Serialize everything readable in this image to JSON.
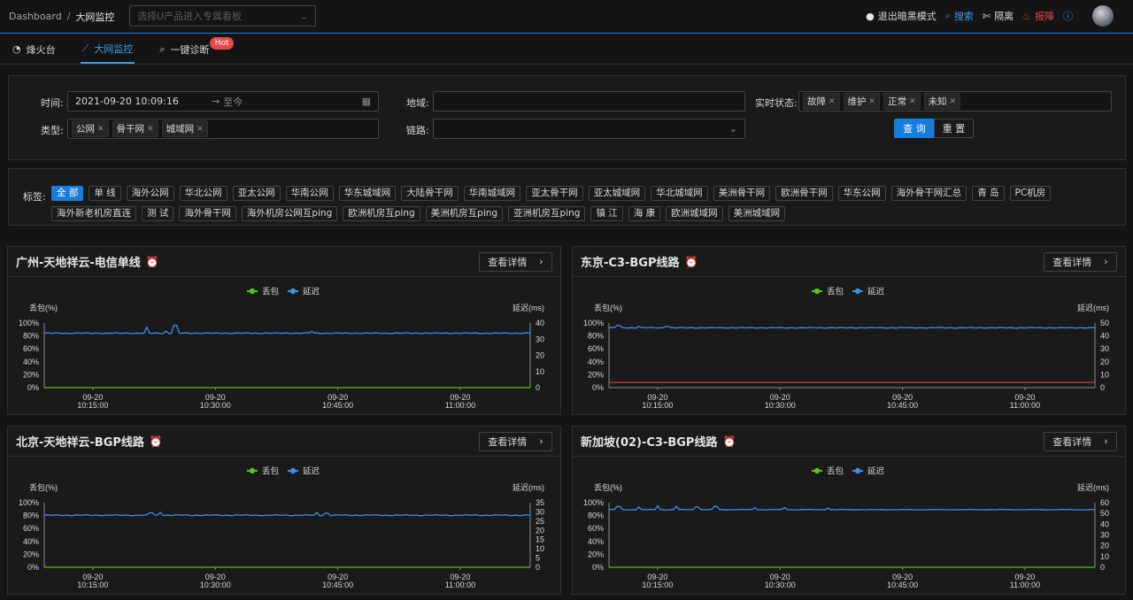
{
  "topbar": {
    "breadcrumb_root": "Dashboard",
    "breadcrumb_sep": "/",
    "breadcrumb_current": "大网监控",
    "board_select_placeholder": "选择U产品进入专属看板",
    "dark_mode": "退出暗黑模式",
    "search": "搜索",
    "isolate": "隔离",
    "report": "报障",
    "help_icon": "question-icon"
  },
  "tabs": [
    {
      "label": "烽火台",
      "icon": "dashboard-icon",
      "active": false
    },
    {
      "label": "大网监控",
      "icon": "line-chart-icon",
      "active": true
    },
    {
      "label": "一键诊断",
      "icon": "search-icon",
      "active": false,
      "badge": "Hot"
    }
  ],
  "filters": {
    "time_label": "时间:",
    "time_start": "2021-09-20 10:09:16",
    "time_arrow": "→",
    "time_end": "至今",
    "region_label": "地域:",
    "status_label": "实时状态:",
    "status_chips": [
      "故障",
      "维护",
      "正常",
      "未知"
    ],
    "type_label": "类型:",
    "type_chips": [
      "公网",
      "骨干网",
      "城域网"
    ],
    "link_label": "链路:",
    "query_button": "查 询",
    "reset_button": "重 置"
  },
  "tags": {
    "label": "标签:",
    "items": [
      "全 部",
      "单 线",
      "海外公网",
      "华北公网",
      "亚太公网",
      "华南公网",
      "华东城域网",
      "大陆骨干网",
      "华南城域网",
      "亚太骨干网",
      "亚太城域网",
      "华北城域网",
      "美洲骨干网",
      "欧洲骨干网",
      "华东公网",
      "海外骨干网汇总",
      "青 岛",
      "PC机房",
      "海外新老机房直连",
      "测 试",
      "海外骨干网",
      "海外机房公网互ping",
      "欧洲机房互ping",
      "美洲机房互ping",
      "亚洲机房互ping",
      "镇 江",
      "海 康",
      "欧洲城域网",
      "美洲城域网"
    ],
    "active_index": 0
  },
  "colors": {
    "accent": "#177ddc",
    "loss_legend": "#52c41a",
    "latency": "#3c8df0",
    "loss_red": "#d9363e"
  },
  "cards": [
    {
      "title": "广州-天地祥云-电信单线",
      "detail": "查看详情",
      "chart_data": {
        "type": "line",
        "legend": [
          "丢包",
          "延迟"
        ],
        "y_left_label": "丢包(%)",
        "y_right_label": "延迟(ms)",
        "y_left_ticks": [
          "100%",
          "80%",
          "60%",
          "40%",
          "20%",
          "0%"
        ],
        "y_right_ticks": [
          "40",
          "30",
          "20",
          "10",
          "0"
        ],
        "y_right_max": 40,
        "x_ticks": [
          [
            "09-20",
            "10:15:00"
          ],
          [
            "09-20",
            "10:30:00"
          ],
          [
            "09-20",
            "10:45:00"
          ],
          [
            "09-20",
            "11:00:00"
          ]
        ],
        "series": [
          {
            "name": "延迟",
            "baseline": 33.7,
            "spikes": [
              [
                0.21,
                37.5
              ],
              [
                0.25,
                35.0
              ],
              [
                0.27,
                38.5
              ],
              [
                0.55,
                34.8
              ]
            ]
          },
          {
            "name": "丢包",
            "baseline_pct": 0,
            "color_key": "loss_legend"
          }
        ]
      }
    },
    {
      "title": "东京-C3-BGP线路",
      "detail": "查看详情",
      "chart_data": {
        "type": "line",
        "legend": [
          "丢包",
          "延迟"
        ],
        "y_left_label": "丢包(%)",
        "y_right_label": "延迟(ms)",
        "y_left_ticks": [
          "100%",
          "80%",
          "60%",
          "40%",
          "20%",
          "0%"
        ],
        "y_right_ticks": [
          "50",
          "40",
          "30",
          "20",
          "10",
          "0"
        ],
        "y_right_max": 50,
        "x_ticks": [
          [
            "09-20",
            "10:15:00"
          ],
          [
            "09-20",
            "10:30:00"
          ],
          [
            "09-20",
            "10:45:00"
          ],
          [
            "09-20",
            "11:00:00"
          ]
        ],
        "series": [
          {
            "name": "延迟",
            "baseline": 46.3,
            "spikes": [
              [
                0.02,
                48.0
              ],
              [
                0.06,
                47.5
              ],
              [
                0.12,
                47.3
              ]
            ]
          },
          {
            "name": "丢包",
            "baseline_pct": 8,
            "color_key": "loss_red"
          }
        ]
      }
    },
    {
      "title": "北京-天地祥云-BGP线路",
      "detail": "查看详情",
      "chart_data": {
        "type": "line",
        "legend": [
          "丢包",
          "延迟"
        ],
        "y_left_label": "丢包(%)",
        "y_right_label": "延迟(ms)",
        "y_left_ticks": [
          "100%",
          "80%",
          "60%",
          "40%",
          "20%",
          "0%"
        ],
        "y_right_ticks": [
          "35",
          "30",
          "25",
          "20",
          "15",
          "10",
          "5",
          "0"
        ],
        "y_right_max": 35,
        "x_ticks": [
          [
            "09-20",
            "10:15:00"
          ],
          [
            "09-20",
            "10:30:00"
          ],
          [
            "09-20",
            "10:45:00"
          ],
          [
            "09-20",
            "11:00:00"
          ]
        ],
        "series": [
          {
            "name": "延迟",
            "baseline": 28.2,
            "spikes": [
              [
                0.22,
                29.5
              ],
              [
                0.24,
                29.7
              ],
              [
                0.56,
                29.7
              ],
              [
                0.58,
                29.3
              ]
            ]
          },
          {
            "name": "丢包",
            "baseline_pct": 0,
            "color_key": "loss_legend"
          }
        ]
      }
    },
    {
      "title": "新加坡(02)-C3-BGP线路",
      "detail": "查看详情",
      "chart_data": {
        "type": "line",
        "legend": [
          "丢包",
          "延迟"
        ],
        "y_left_label": "丢包(%)",
        "y_right_label": "延迟(ms)",
        "y_left_ticks": [
          "100%",
          "80%",
          "60%",
          "40%",
          "20%",
          "0%"
        ],
        "y_right_ticks": [
          "60",
          "50",
          "40",
          "30",
          "20",
          "10",
          "0"
        ],
        "y_right_max": 60,
        "x_ticks": [
          [
            "09-20",
            "10:15:00"
          ],
          [
            "09-20",
            "10:30:00"
          ],
          [
            "09-20",
            "10:45:00"
          ],
          [
            "09-20",
            "11:00:00"
          ]
        ],
        "series": [
          {
            "name": "延迟",
            "baseline": 53.5,
            "spikes": [
              [
                0.02,
                56.5
              ],
              [
                0.06,
                56.0
              ],
              [
                0.1,
                57.0
              ],
              [
                0.14,
                56.5
              ],
              [
                0.18,
                56.0
              ],
              [
                0.22,
                56.5
              ],
              [
                0.3,
                55.5
              ],
              [
                0.36,
                55.5
              ],
              [
                0.45,
                55.0
              ]
            ]
          },
          {
            "name": "丢包",
            "baseline_pct": 0,
            "color_key": "loss_legend"
          }
        ]
      }
    }
  ]
}
